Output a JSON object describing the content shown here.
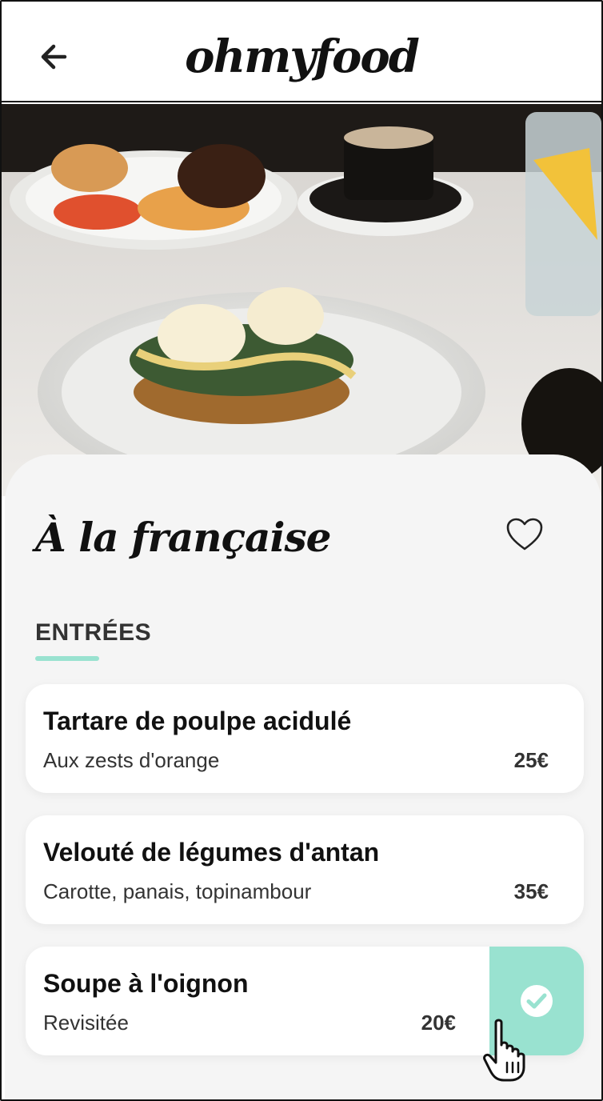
{
  "app": {
    "logo": "ohmyfood"
  },
  "header": {
    "back_icon": "arrow-left-icon"
  },
  "restaurant": {
    "title": "À la française",
    "favorite_icon": "heart-outline-icon"
  },
  "menu": {
    "section_title": "ENTRÉES",
    "accent_color": "#99e2d0",
    "dishes": [
      {
        "name": "Tartare de poulpe acidulé",
        "description": "Aux zests d'orange",
        "price": "25€",
        "selected": false
      },
      {
        "name": "Velouté de légumes d'antan",
        "description": "Carotte, panais, topinambour",
        "price": "35€",
        "selected": false
      },
      {
        "name": "Soupe à l'oignon",
        "description": "Revisitée",
        "price": "20€",
        "selected": true,
        "check_icon": "check-circle-icon"
      }
    ]
  },
  "pointer": {
    "icon": "hand-pointer-icon"
  }
}
